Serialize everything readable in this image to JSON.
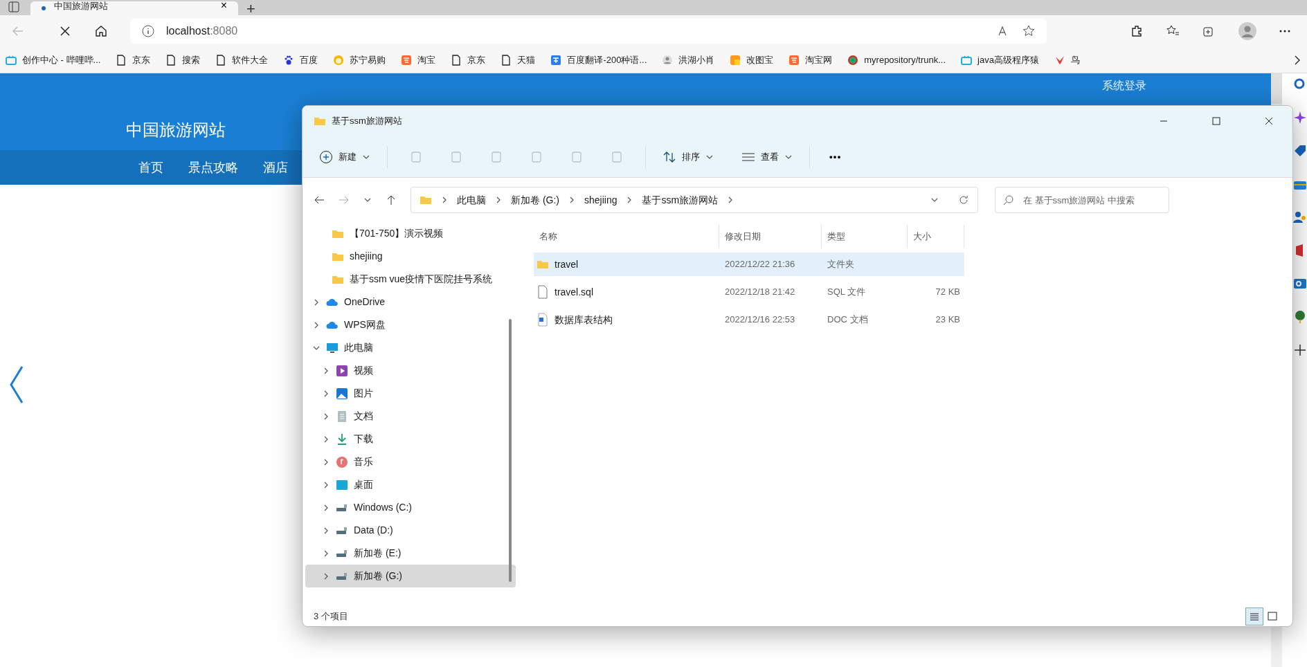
{
  "browser": {
    "tab": {
      "title": "中国旅游网站",
      "close": "×"
    },
    "new_tab": "+",
    "address": {
      "host": "localhost",
      "port": ":8080"
    },
    "bookmarks": [
      {
        "label": "创作中心 - 哔哩哔...",
        "kind": "tv"
      },
      {
        "label": "京东",
        "kind": "page"
      },
      {
        "label": "搜索",
        "kind": "page"
      },
      {
        "label": "软件大全",
        "kind": "page"
      },
      {
        "label": "百度",
        "kind": "paw"
      },
      {
        "label": "苏宁易购",
        "kind": "sun"
      },
      {
        "label": "淘宝",
        "kind": "tao"
      },
      {
        "label": "京东",
        "kind": "page"
      },
      {
        "label": "天猫",
        "kind": "page"
      },
      {
        "label": "百度翻译-200种语...",
        "kind": "translate"
      },
      {
        "label": "洪湖小肖",
        "kind": "avatar"
      },
      {
        "label": "改图宝",
        "kind": "square"
      },
      {
        "label": "淘宝网",
        "kind": "tao"
      },
      {
        "label": "myrepository/trunk...",
        "kind": "circle"
      },
      {
        "label": "java高级程序猿",
        "kind": "tv"
      },
      {
        "label": "鸟",
        "kind": "bird"
      }
    ]
  },
  "site": {
    "title": "中国旅游网站",
    "login": "系统登录",
    "nav": [
      "首页",
      "景点攻略",
      "酒店"
    ]
  },
  "explorer": {
    "title": "基于ssm旅游网站",
    "new": "新建",
    "sort": "排序",
    "view": "查看",
    "more": "•••",
    "breadcrumb": [
      "此电脑",
      "新加卷 (G:)",
      "shejiing",
      "基于ssm旅游网站"
    ],
    "search": {
      "placeholder": "在 基于ssm旅游网站 中搜索"
    },
    "quick_items": [
      {
        "label": "【701-750】演示视频",
        "kind": "folder",
        "selected": false
      },
      {
        "label": "shejiing",
        "kind": "folder",
        "selected": false
      },
      {
        "label": "基于ssm vue疫情下医院挂号系统",
        "kind": "folder",
        "selected": false
      }
    ],
    "tree": [
      {
        "label": "OneDrive",
        "kind": "cloud",
        "expanded": false,
        "selected": false
      },
      {
        "label": "WPS网盘",
        "kind": "cloud",
        "expanded": false,
        "selected": false
      },
      {
        "label": "此电脑",
        "kind": "pc",
        "expanded": true,
        "selected": false,
        "children": [
          {
            "label": "视频",
            "kind": "video",
            "expanded": false,
            "selected": false
          },
          {
            "label": "图片",
            "kind": "picture",
            "expanded": false,
            "selected": false
          },
          {
            "label": "文档",
            "kind": "doc",
            "expanded": false,
            "selected": false
          },
          {
            "label": "下载",
            "kind": "download",
            "expanded": false,
            "selected": false
          },
          {
            "label": "音乐",
            "kind": "music",
            "expanded": false,
            "selected": false
          },
          {
            "label": "桌面",
            "kind": "desktop",
            "expanded": false,
            "selected": false
          },
          {
            "label": "Windows (C:)",
            "kind": "drive",
            "expanded": false,
            "selected": false
          },
          {
            "label": "Data (D:)",
            "kind": "drive",
            "expanded": false,
            "selected": false
          },
          {
            "label": "新加卷 (E:)",
            "kind": "drive",
            "expanded": false,
            "selected": false
          },
          {
            "label": "新加卷 (G:)",
            "kind": "drive",
            "expanded": false,
            "selected": true
          }
        ]
      }
    ],
    "columns": [
      "名称",
      "修改日期",
      "类型",
      "大小"
    ],
    "rows": [
      {
        "name": "travel",
        "date": "2022/12/22 21:36",
        "type": "文件夹",
        "kind": "folder",
        "selected": true
      },
      {
        "name": "travel.sql",
        "date": "2022/12/18 21:42",
        "type": "SQL 文件",
        "size": "72 KB",
        "kind": "sql",
        "selected": false
      },
      {
        "name": "数据库表结构",
        "date": "2022/12/16 22:53",
        "type": "DOC 文档",
        "size": "23 KB",
        "kind": "doc",
        "selected": false
      }
    ],
    "status": "3 个项目",
    "view_modes": [
      {
        "kind": "details",
        "selected": true
      },
      {
        "kind": "tiles",
        "selected": false
      }
    ]
  }
}
